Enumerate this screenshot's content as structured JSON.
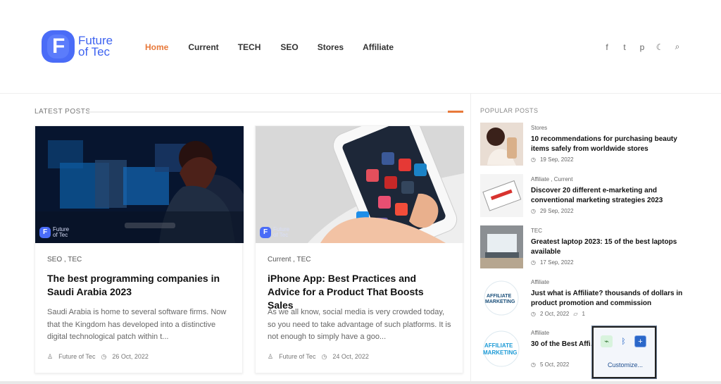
{
  "header": {
    "logo_text": "Future\nof Tec",
    "nav": [
      "Home",
      "Current",
      "TECH",
      "SEO",
      "Stores",
      "Affiliate"
    ],
    "social_icons": [
      "facebook-icon",
      "twitter-icon",
      "pinterest-icon",
      "theme-toggle-icon",
      "search-icon"
    ]
  },
  "main": {
    "section_title": "LATEST POSTS",
    "posts": [
      {
        "category": "SEO , TEC",
        "title": "The best programming companies in Saudi Arabia 2023",
        "excerpt": "Saudi Arabia is home to several software firms. Now that the Kingdom has developed into a distinctive digital technological patch within t...",
        "author": "Future of Tec",
        "date": "26 Oct, 2022"
      },
      {
        "category": "Current , TEC",
        "title": "iPhone App: Best Practices and Advice for a Product That Boosts Sales",
        "excerpt": "As we all know, social media is very crowded today, so you need to take advantage of such platforms. It is not enough to simply have a goo...",
        "author": "Future of Tec",
        "date": "24 Oct, 2022"
      }
    ]
  },
  "sidebar": {
    "title": "POPULAR POSTS",
    "items": [
      {
        "category": "Stores",
        "title": "10 recommendations for purchasing beauty items safely from worldwide stores",
        "date": "19 Sep, 2022",
        "comments": ""
      },
      {
        "category": "Affiliate , Current",
        "title": "Discover 20 different e-marketing and conventional marketing strategies 2023",
        "date": "29 Sep, 2022",
        "comments": ""
      },
      {
        "category": "TEC",
        "title": "Greatest laptop 2023: 15 of the best laptops available",
        "date": "17 Sep, 2022",
        "comments": ""
      },
      {
        "category": "Affiliate",
        "title": "Just what is Affiliate? thousands of dollars in product promotion and commission",
        "date": "2 Oct, 2022",
        "comments": "1"
      },
      {
        "category": "Affiliate",
        "title": "30 of the Best Affi… …oin in 2023",
        "date": "5 Oct, 2022",
        "comments": ""
      }
    ]
  },
  "tray": {
    "customize": "Customize..."
  },
  "watermark": "Future\nof Tec",
  "colors": {
    "accent": "#e8793a",
    "brand": "#4a6cf7"
  }
}
